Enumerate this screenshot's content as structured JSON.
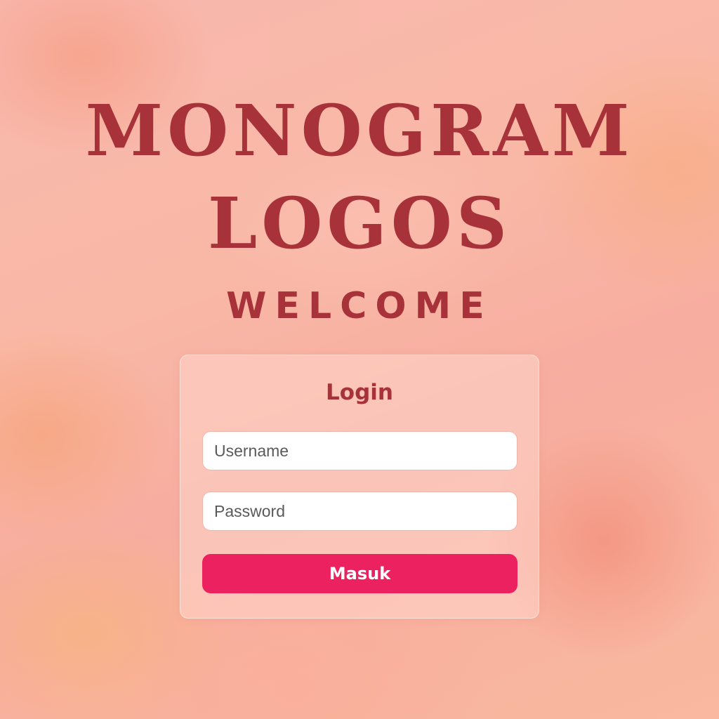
{
  "header": {
    "title_line_1": "MONOGRAM",
    "title_line_2": "LOGOS",
    "welcome": "WELCOME"
  },
  "login": {
    "title": "Login",
    "username_placeholder": "Username",
    "password_placeholder": "Password",
    "submit_label": "Masuk"
  },
  "colors": {
    "brand": "#a8323a",
    "accent": "#ec2260"
  }
}
